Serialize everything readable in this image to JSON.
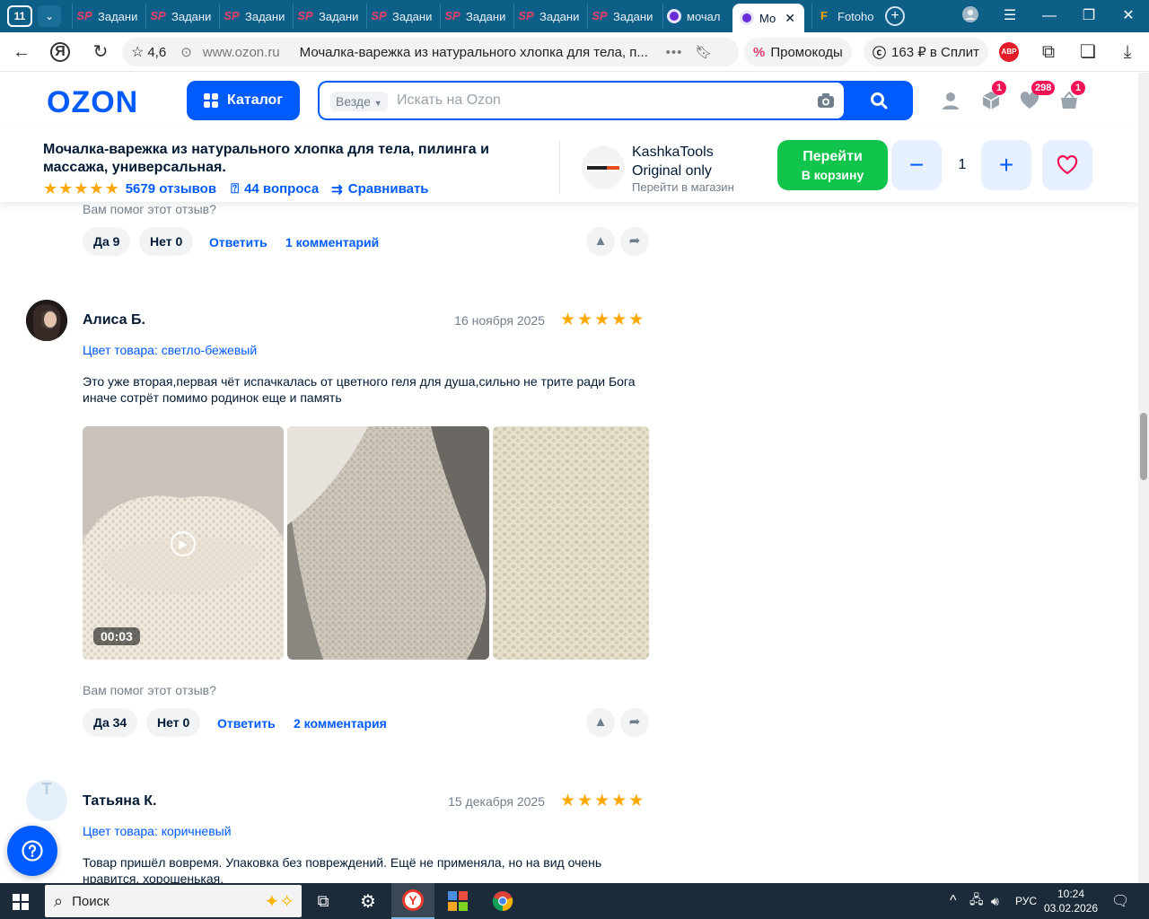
{
  "browser": {
    "tab_count": "11",
    "tabs": [
      {
        "label": "Задани"
      },
      {
        "label": "Задани"
      },
      {
        "label": "Задани"
      },
      {
        "label": "Задани"
      },
      {
        "label": "Задани"
      },
      {
        "label": "Задани"
      },
      {
        "label": "Задани"
      },
      {
        "label": "Задани"
      },
      {
        "label": "мочал"
      },
      {
        "label": "Мо"
      },
      {
        "label": "Fotoho"
      }
    ],
    "rating": "4,6",
    "domain": "www.ozon.ru",
    "page_title": "Мочалка-варежка из натурального хлопка для тела, п...",
    "promo_label": "Промокоды",
    "split_label": "163 ₽ в Сплит",
    "abp_label": "ABP"
  },
  "header": {
    "logo": "OZON",
    "catalog_label": "Каталог",
    "scope_label": "Везде",
    "search_placeholder": "Искать на Ozon",
    "orders_badge": "1",
    "favorites_badge": "298",
    "cart_badge": "1"
  },
  "product": {
    "title": "Мочалка-варежка из натурального хлопка для тела, пилинга и массажа, универсальная.",
    "reviews_count": "5679 отзывов",
    "questions_count": "44 вопроса",
    "compare_label": "Сравнивать",
    "store_name": "KashkaTools Original only",
    "store_link": "Перейти в магазин",
    "go_button_line1": "Перейти",
    "go_button_line2": "В корзину",
    "quantity": "1",
    "stars": 5
  },
  "reviews": {
    "helpful_question": "Вам помог этот отзыв?",
    "answer_label": "Ответить",
    "previous": {
      "yes": "Да 9",
      "no": "Нет 0",
      "comments": "1 комментарий"
    },
    "items": [
      {
        "author": "Алиса Б.",
        "date": "16 ноября 2025",
        "stars": 5,
        "color_attr": "Цвет товара: светло-бежевый",
        "text": "Это уже вторая,первая чёт испачкалась от цветного геля для душа,сильно не трите ради Бога иначе сотрёт помимо родинок еще и память",
        "video_duration": "00:03",
        "yes": "Да 34",
        "no": "Нет 0",
        "comments": "2 комментария"
      },
      {
        "author": "Татьяна К.",
        "avatar_letter": "Т",
        "date": "15 декабря 2025",
        "stars": 5,
        "color_attr": "Цвет товара: коричневый",
        "text": "Товар пришёл вовремя. Упаковка без повреждений. Ещё не применяла, но на вид очень нравится, хорошенькая."
      }
    ]
  },
  "taskbar": {
    "search_label": "Поиск",
    "language": "РУС",
    "time": "10:24",
    "date": "03.02.2026"
  },
  "colors": {
    "ozon_blue": "#005bff",
    "go_green": "#10c44c",
    "star": "#ffa800",
    "badge": "#f91155",
    "tabstrip": "#0e5f88"
  }
}
